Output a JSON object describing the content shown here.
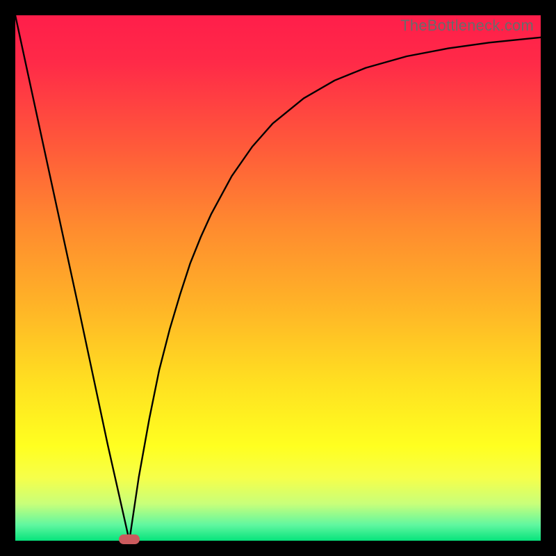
{
  "watermark": "TheBottleneck.com",
  "colors": {
    "background": "#000000",
    "gradient_top": "#ff1e4a",
    "gradient_bottom": "#06e37c",
    "curve": "#000000",
    "marker": "#cc5a5d"
  },
  "chart_data": {
    "type": "line",
    "title": "",
    "xlabel": "",
    "ylabel": "",
    "xlim": [
      0,
      100
    ],
    "ylim": [
      0,
      100
    ],
    "grid": false,
    "legend": false,
    "series": [
      {
        "name": "left-branch",
        "x": [
          0,
          5.9,
          11.8,
          17.6,
          21.7
        ],
        "values": [
          100,
          72.7,
          45.5,
          18.2,
          0
        ]
      },
      {
        "name": "right-branch",
        "x": [
          21.7,
          23.5,
          25.5,
          27.4,
          29.4,
          31.4,
          33.3,
          35.3,
          37.3,
          41.2,
          45.1,
          49.0,
          54.9,
          60.8,
          66.7,
          74.5,
          82.4,
          90.2,
          100
        ],
        "values": [
          0,
          12.1,
          23.2,
          32.5,
          40.3,
          47.0,
          52.8,
          57.8,
          62.2,
          69.4,
          75.0,
          79.4,
          84.2,
          87.6,
          90.0,
          92.2,
          93.7,
          94.8,
          95.8
        ]
      }
    ],
    "marker": {
      "x": 21.7,
      "y": 0,
      "shape": "pill"
    },
    "annotations": []
  }
}
